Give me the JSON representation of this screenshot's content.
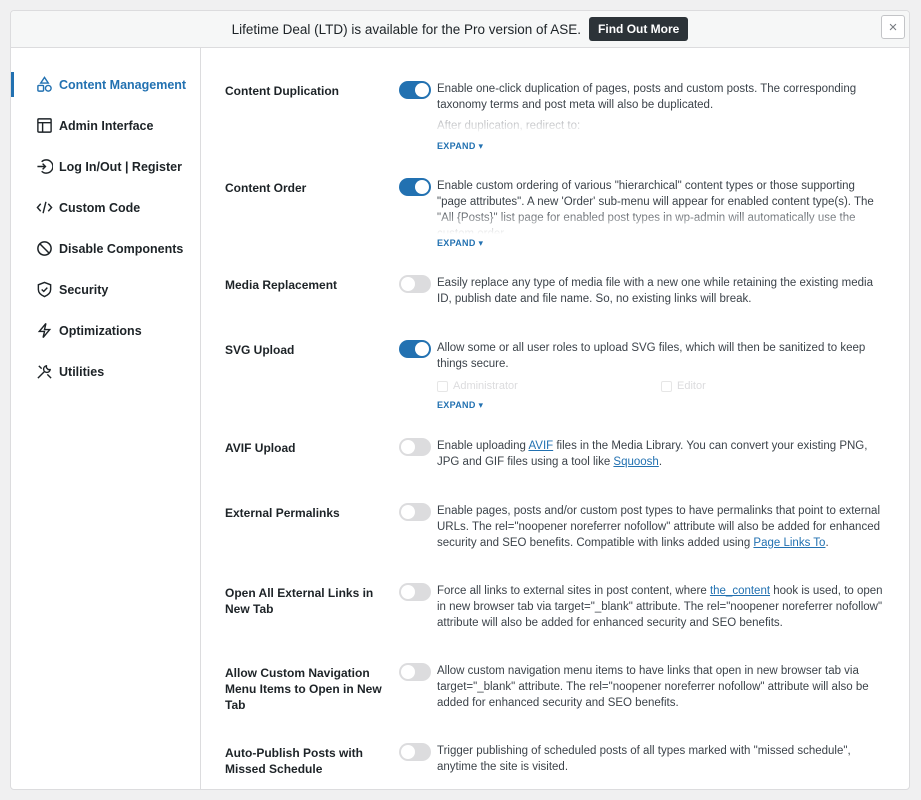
{
  "banner": {
    "text": "Lifetime Deal (LTD) is available for the Pro version of ASE.",
    "button": "Find Out More"
  },
  "close_icon": "×",
  "sidebar": {
    "items": [
      {
        "label": "Content Management",
        "icon": "shapes-icon",
        "active": true
      },
      {
        "label": "Admin Interface",
        "icon": "layout-icon"
      },
      {
        "label": "Log In/Out | Register",
        "icon": "login-icon"
      },
      {
        "label": "Custom Code",
        "icon": "code-icon"
      },
      {
        "label": "Disable Components",
        "icon": "disable-icon"
      },
      {
        "label": "Security",
        "icon": "shield-icon"
      },
      {
        "label": "Optimizations",
        "icon": "bolt-icon"
      },
      {
        "label": "Utilities",
        "icon": "tools-icon"
      }
    ]
  },
  "expand_label": "EXPAND ▾",
  "settings": {
    "content_duplication": {
      "title": "Content Duplication",
      "enabled": true,
      "desc": "Enable one-click duplication of pages, posts and custom posts. The corresponding taxonomy terms and post meta will also be duplicated.",
      "faded": "After duplication, redirect to:"
    },
    "content_order": {
      "title": "Content Order",
      "enabled": true,
      "desc": "Enable custom ordering of various \"hierarchical\" content types or those supporting \"page attributes\". A new 'Order' sub-menu will appear for enabled content type(s). The \"All {Posts}\" list page for enabled post types in wp-admin will automatically use the custom order."
    },
    "media_replacement": {
      "title": "Media Replacement",
      "enabled": false,
      "desc": "Easily replace any type of media file with a new one while retaining the existing media ID, publish date and file name. So, no existing links will break."
    },
    "svg_upload": {
      "title": "SVG Upload",
      "enabled": true,
      "desc": "Allow some or all user roles to upload SVG files, which will then be sanitized to keep things secure.",
      "roles": [
        "Administrator",
        "Editor"
      ]
    },
    "avif_upload": {
      "title": "AVIF Upload",
      "enabled": false,
      "desc_a": "Enable uploading ",
      "link1": "AVIF",
      "desc_b": " files in the Media Library. You can convert your existing PNG, JPG and GIF files using a tool like ",
      "link2": "Squoosh",
      "desc_c": "."
    },
    "external_permalinks": {
      "title": "External Permalinks",
      "enabled": false,
      "desc_a": "Enable pages, posts and/or custom post types to have permalinks that point to external URLs. The rel=\"noopener noreferrer nofollow\" attribute will also be added for enhanced security and SEO benefits. Compatible with links added using ",
      "link": "Page Links To",
      "desc_b": "."
    },
    "open_external_links": {
      "title": "Open All External Links in New Tab",
      "enabled": false,
      "desc_a": "Force all links to external sites in post content, where ",
      "link": "the_content",
      "desc_b": " hook is used, to open in new browser tab via target=\"_blank\" attribute. The rel=\"noopener noreferrer nofollow\" attribute will also be added for enhanced security and SEO benefits."
    },
    "custom_nav_new_tab": {
      "title": "Allow Custom Navigation Menu Items to Open in New Tab",
      "enabled": false,
      "desc": "Allow custom navigation menu items to have links that open in new browser tab via target=\"_blank\" attribute. The rel=\"noopener noreferrer nofollow\" attribute will also be added for enhanced security and SEO benefits."
    },
    "auto_publish": {
      "title": "Auto-Publish Posts with Missed Schedule",
      "enabled": false,
      "desc": "Trigger publishing of scheduled posts of all types marked with \"missed schedule\", anytime the site is visited."
    }
  }
}
